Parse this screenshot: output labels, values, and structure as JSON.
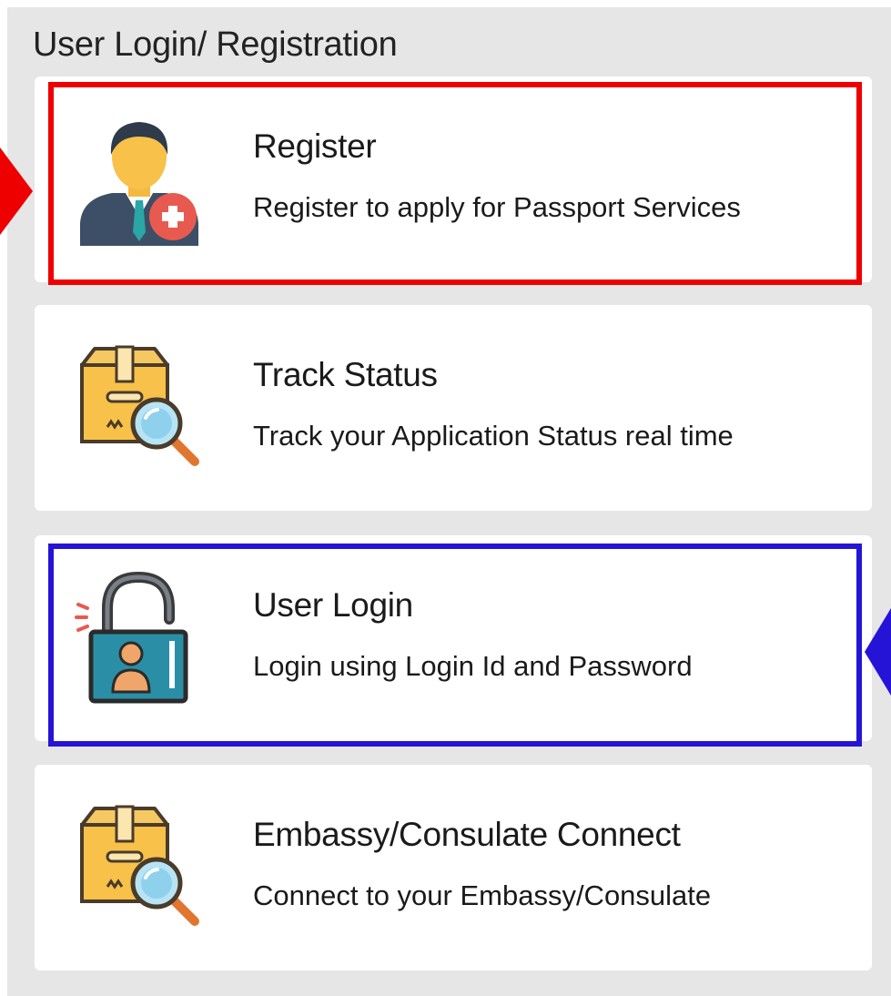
{
  "panel": {
    "title": "User Login/ Registration"
  },
  "cards": [
    {
      "title": "Register",
      "description": "Register to apply for Passport Services",
      "icon": "user-add-icon"
    },
    {
      "title": "Track Status",
      "description": "Track your Application Status real time",
      "icon": "package-search-icon"
    },
    {
      "title": "User Login",
      "description": "Login using Login Id and Password",
      "icon": "unlock-user-icon"
    },
    {
      "title": "Embassy/Consulate Connect",
      "description": "Connect to your Embassy/Consulate",
      "icon": "package-search-icon"
    }
  ],
  "annotations": {
    "highlight_register_color": "#ee0000",
    "highlight_login_color": "#2614d6"
  }
}
